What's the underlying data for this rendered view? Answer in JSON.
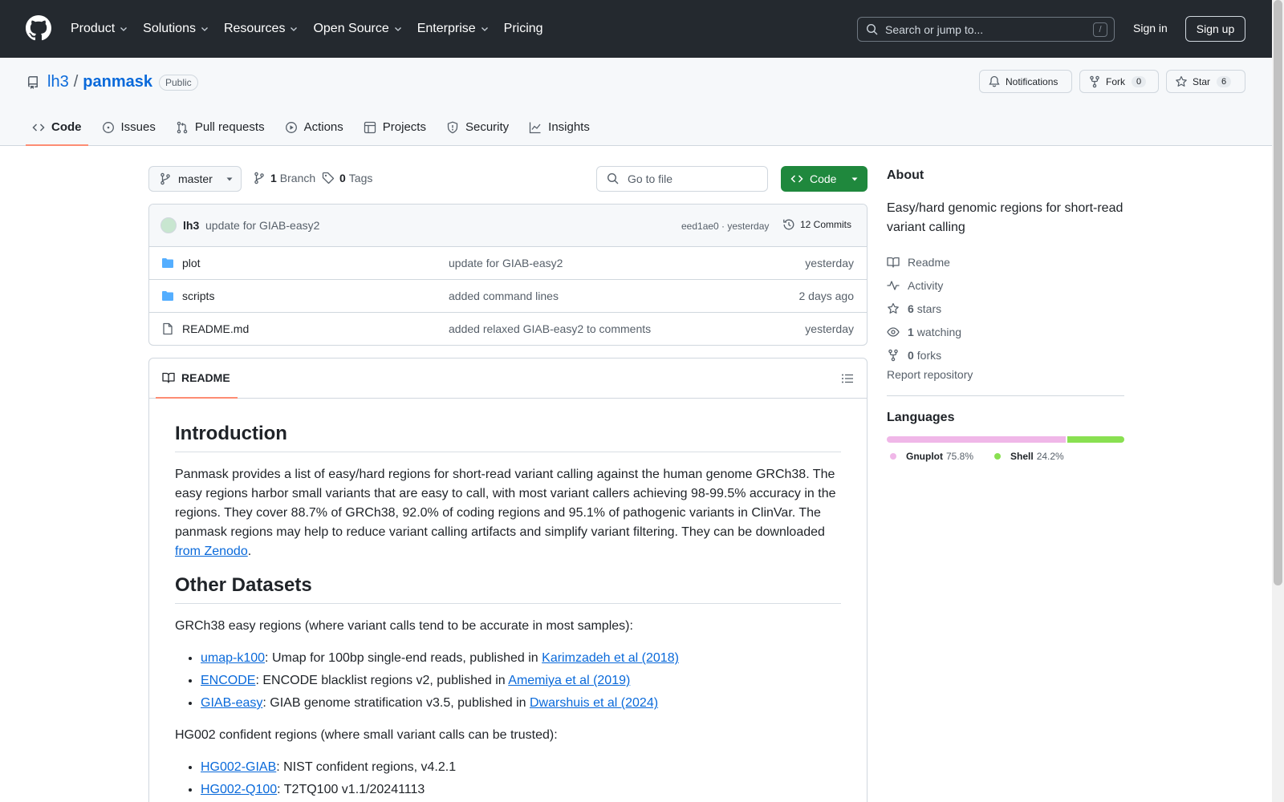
{
  "header": {
    "nav": [
      "Product",
      "Solutions",
      "Resources",
      "Open Source",
      "Enterprise",
      "Pricing"
    ],
    "search_placeholder": "Search or jump to...",
    "search_shortcut": "/",
    "signin": "Sign in",
    "signup": "Sign up"
  },
  "repo": {
    "owner": "lh3",
    "separator": "/",
    "name": "panmask",
    "visibility": "Public",
    "notifications": "Notifications",
    "fork": "Fork",
    "fork_count": "0",
    "star": "Star",
    "star_count": "6",
    "tabs": [
      "Code",
      "Issues",
      "Pull requests",
      "Actions",
      "Projects",
      "Security",
      "Insights"
    ]
  },
  "branchbar": {
    "branch": "master",
    "branch_count": "1",
    "branch_label": "Branch",
    "tag_count": "0",
    "tag_label": "Tags",
    "goto_file": "Go to file",
    "code_button": "Code"
  },
  "commit": {
    "author": "lh3",
    "message": "update for GIAB-easy2",
    "hash_time": "eed1ae0 · yesterday",
    "commits": "12 Commits"
  },
  "files": [
    {
      "type": "folder",
      "name": "plot",
      "message": "update for GIAB-easy2",
      "date": "yesterday"
    },
    {
      "type": "folder",
      "name": "scripts",
      "message": "added command lines",
      "date": "2 days ago"
    },
    {
      "type": "file",
      "name": "README.md",
      "message": "added relaxed GIAB-easy2 to comments",
      "date": "yesterday"
    }
  ],
  "readme": {
    "tab": "README",
    "h_intro": "Introduction",
    "intro_text": "Panmask provides a list of easy/hard regions for short-read variant calling against the human genome GRCh38. The easy regions harbor small variants that are easy to call, with most variant callers achieving 98-99.5% accuracy in the regions. They cover 88.7% of GRCh38, 92.0% of coding regions and 95.1% of pathogenic variants in ClinVar. The panmask regions may help to reduce variant calling artifacts and simplify variant filtering. They can be downloaded ",
    "intro_link": "from Zenodo",
    "intro_end": ".",
    "h_other": "Other Datasets",
    "easy_intro": "GRCh38 easy regions (where variant calls tend to be accurate in most samples):",
    "easy_items": [
      {
        "link": "umap-k100",
        "text": ": Umap for 100bp single-end reads, published in ",
        "ref": "Karimzadeh et al (2018)"
      },
      {
        "link": "ENCODE",
        "text": ": ENCODE blacklist regions v2, published in ",
        "ref": "Amemiya et al (2019)"
      },
      {
        "link": "GIAB-easy",
        "text": ": GIAB genome stratification v3.5, published in ",
        "ref": "Dwarshuis et al (2024)"
      }
    ],
    "hg002_intro": "HG002 confident regions (where small variant calls can be trusted):",
    "hg002_items": [
      {
        "link": "HG002-GIAB",
        "text": ": NIST confident regions, v4.2.1"
      },
      {
        "link": "HG002-Q100",
        "text": ": T2TQ100 v1.1/20241113"
      }
    ]
  },
  "about": {
    "title": "About",
    "description": "Easy/hard genomic regions for short-read variant calling",
    "readme": "Readme",
    "activity": "Activity",
    "stars_count": "6",
    "stars_label": "stars",
    "watching_count": "1",
    "watching_label": "watching",
    "forks_count": "0",
    "forks_label": "forks",
    "report": "Report repository"
  },
  "languages": {
    "title": "Languages",
    "items": [
      {
        "name": "Gnuplot",
        "percent": "75.8%",
        "value": 75.8,
        "color": "#f0b7e8"
      },
      {
        "name": "Shell",
        "percent": "24.2%",
        "value": 24.2,
        "color": "#89e051"
      }
    ]
  }
}
